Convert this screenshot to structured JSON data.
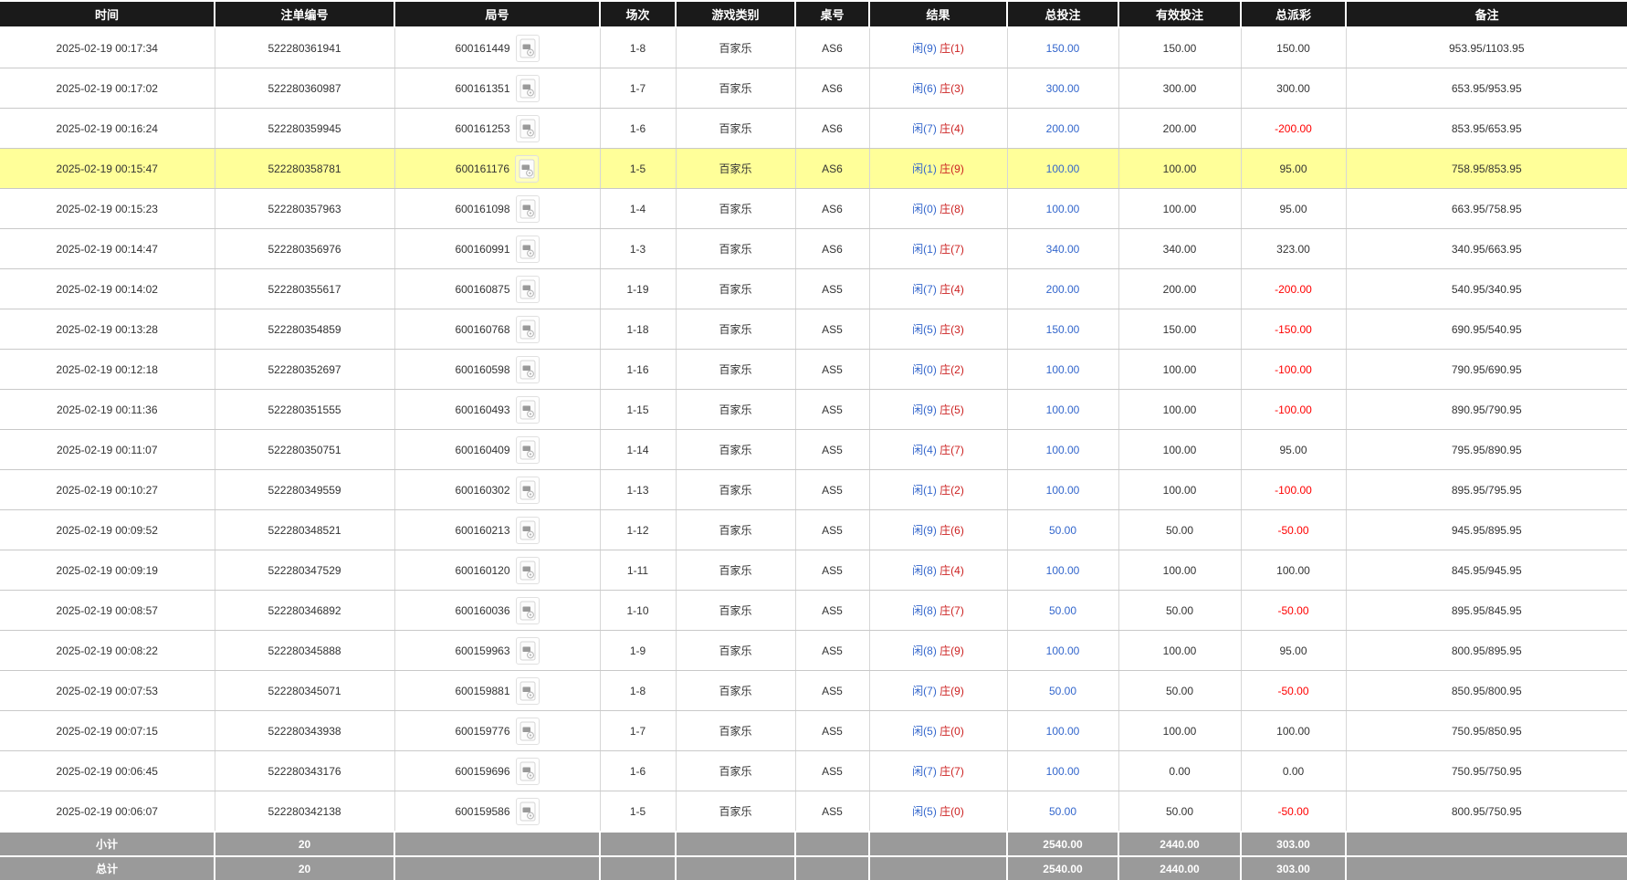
{
  "header": {
    "columns": [
      "时间",
      "注单编号",
      "局号",
      "场次",
      "游戏类别",
      "桌号",
      "结果",
      "总投注",
      "有效投注",
      "总派彩",
      "备注"
    ]
  },
  "rows": [
    {
      "time": "2025-02-19 00:17:34",
      "bet_id": "522280361941",
      "round_id": "600161449",
      "session": "1-8",
      "game_type": "百家乐",
      "table_no": "AS6",
      "result_player": "闲(9)",
      "result_banker": "庄(1)",
      "total_bet": "150.00",
      "valid_bet": "150.00",
      "payout": "150.00",
      "remark": "953.95/1103.95",
      "highlighted": false
    },
    {
      "time": "2025-02-19 00:17:02",
      "bet_id": "522280360987",
      "round_id": "600161351",
      "session": "1-7",
      "game_type": "百家乐",
      "table_no": "AS6",
      "result_player": "闲(6)",
      "result_banker": "庄(3)",
      "total_bet": "300.00",
      "valid_bet": "300.00",
      "payout": "300.00",
      "remark": "653.95/953.95",
      "highlighted": false
    },
    {
      "time": "2025-02-19 00:16:24",
      "bet_id": "522280359945",
      "round_id": "600161253",
      "session": "1-6",
      "game_type": "百家乐",
      "table_no": "AS6",
      "result_player": "闲(7)",
      "result_banker": "庄(4)",
      "total_bet": "200.00",
      "valid_bet": "200.00",
      "payout": "-200.00",
      "remark": "853.95/653.95",
      "highlighted": false
    },
    {
      "time": "2025-02-19 00:15:47",
      "bet_id": "522280358781",
      "round_id": "600161176",
      "session": "1-5",
      "game_type": "百家乐",
      "table_no": "AS6",
      "result_player": "闲(1)",
      "result_banker": "庄(9)",
      "total_bet": "100.00",
      "valid_bet": "100.00",
      "payout": "95.00",
      "remark": "758.95/853.95",
      "highlighted": true
    },
    {
      "time": "2025-02-19 00:15:23",
      "bet_id": "522280357963",
      "round_id": "600161098",
      "session": "1-4",
      "game_type": "百家乐",
      "table_no": "AS6",
      "result_player": "闲(0)",
      "result_banker": "庄(8)",
      "total_bet": "100.00",
      "valid_bet": "100.00",
      "payout": "95.00",
      "remark": "663.95/758.95",
      "highlighted": false
    },
    {
      "time": "2025-02-19 00:14:47",
      "bet_id": "522280356976",
      "round_id": "600160991",
      "session": "1-3",
      "game_type": "百家乐",
      "table_no": "AS6",
      "result_player": "闲(1)",
      "result_banker": "庄(7)",
      "total_bet": "340.00",
      "valid_bet": "340.00",
      "payout": "323.00",
      "remark": "340.95/663.95",
      "highlighted": false
    },
    {
      "time": "2025-02-19 00:14:02",
      "bet_id": "522280355617",
      "round_id": "600160875",
      "session": "1-19",
      "game_type": "百家乐",
      "table_no": "AS5",
      "result_player": "闲(7)",
      "result_banker": "庄(4)",
      "total_bet": "200.00",
      "valid_bet": "200.00",
      "payout": "-200.00",
      "remark": "540.95/340.95",
      "highlighted": false
    },
    {
      "time": "2025-02-19 00:13:28",
      "bet_id": "522280354859",
      "round_id": "600160768",
      "session": "1-18",
      "game_type": "百家乐",
      "table_no": "AS5",
      "result_player": "闲(5)",
      "result_banker": "庄(3)",
      "total_bet": "150.00",
      "valid_bet": "150.00",
      "payout": "-150.00",
      "remark": "690.95/540.95",
      "highlighted": false
    },
    {
      "time": "2025-02-19 00:12:18",
      "bet_id": "522280352697",
      "round_id": "600160598",
      "session": "1-16",
      "game_type": "百家乐",
      "table_no": "AS5",
      "result_player": "闲(0)",
      "result_banker": "庄(2)",
      "total_bet": "100.00",
      "valid_bet": "100.00",
      "payout": "-100.00",
      "remark": "790.95/690.95",
      "highlighted": false
    },
    {
      "time": "2025-02-19 00:11:36",
      "bet_id": "522280351555",
      "round_id": "600160493",
      "session": "1-15",
      "game_type": "百家乐",
      "table_no": "AS5",
      "result_player": "闲(9)",
      "result_banker": "庄(5)",
      "total_bet": "100.00",
      "valid_bet": "100.00",
      "payout": "-100.00",
      "remark": "890.95/790.95",
      "highlighted": false
    },
    {
      "time": "2025-02-19 00:11:07",
      "bet_id": "522280350751",
      "round_id": "600160409",
      "session": "1-14",
      "game_type": "百家乐",
      "table_no": "AS5",
      "result_player": "闲(4)",
      "result_banker": "庄(7)",
      "total_bet": "100.00",
      "valid_bet": "100.00",
      "payout": "95.00",
      "remark": "795.95/890.95",
      "highlighted": false
    },
    {
      "time": "2025-02-19 00:10:27",
      "bet_id": "522280349559",
      "round_id": "600160302",
      "session": "1-13",
      "game_type": "百家乐",
      "table_no": "AS5",
      "result_player": "闲(1)",
      "result_banker": "庄(2)",
      "total_bet": "100.00",
      "valid_bet": "100.00",
      "payout": "-100.00",
      "remark": "895.95/795.95",
      "highlighted": false
    },
    {
      "time": "2025-02-19 00:09:52",
      "bet_id": "522280348521",
      "round_id": "600160213",
      "session": "1-12",
      "game_type": "百家乐",
      "table_no": "AS5",
      "result_player": "闲(9)",
      "result_banker": "庄(6)",
      "total_bet": "50.00",
      "valid_bet": "50.00",
      "payout": "-50.00",
      "remark": "945.95/895.95",
      "highlighted": false
    },
    {
      "time": "2025-02-19 00:09:19",
      "bet_id": "522280347529",
      "round_id": "600160120",
      "session": "1-11",
      "game_type": "百家乐",
      "table_no": "AS5",
      "result_player": "闲(8)",
      "result_banker": "庄(4)",
      "total_bet": "100.00",
      "valid_bet": "100.00",
      "payout": "100.00",
      "remark": "845.95/945.95",
      "highlighted": false
    },
    {
      "time": "2025-02-19 00:08:57",
      "bet_id": "522280346892",
      "round_id": "600160036",
      "session": "1-10",
      "game_type": "百家乐",
      "table_no": "AS5",
      "result_player": "闲(8)",
      "result_banker": "庄(7)",
      "total_bet": "50.00",
      "valid_bet": "50.00",
      "payout": "-50.00",
      "remark": "895.95/845.95",
      "highlighted": false
    },
    {
      "time": "2025-02-19 00:08:22",
      "bet_id": "522280345888",
      "round_id": "600159963",
      "session": "1-9",
      "game_type": "百家乐",
      "table_no": "AS5",
      "result_player": "闲(8)",
      "result_banker": "庄(9)",
      "total_bet": "100.00",
      "valid_bet": "100.00",
      "payout": "95.00",
      "remark": "800.95/895.95",
      "highlighted": false
    },
    {
      "time": "2025-02-19 00:07:53",
      "bet_id": "522280345071",
      "round_id": "600159881",
      "session": "1-8",
      "game_type": "百家乐",
      "table_no": "AS5",
      "result_player": "闲(7)",
      "result_banker": "庄(9)",
      "total_bet": "50.00",
      "valid_bet": "50.00",
      "payout": "-50.00",
      "remark": "850.95/800.95",
      "highlighted": false
    },
    {
      "time": "2025-02-19 00:07:15",
      "bet_id": "522280343938",
      "round_id": "600159776",
      "session": "1-7",
      "game_type": "百家乐",
      "table_no": "AS5",
      "result_player": "闲(5)",
      "result_banker": "庄(0)",
      "total_bet": "100.00",
      "valid_bet": "100.00",
      "payout": "100.00",
      "remark": "750.95/850.95",
      "highlighted": false
    },
    {
      "time": "2025-02-19 00:06:45",
      "bet_id": "522280343176",
      "round_id": "600159696",
      "session": "1-6",
      "game_type": "百家乐",
      "table_no": "AS5",
      "result_player": "闲(7)",
      "result_banker": "庄(7)",
      "total_bet": "100.00",
      "valid_bet": "0.00",
      "payout": "0.00",
      "remark": "750.95/750.95",
      "highlighted": false
    },
    {
      "time": "2025-02-19 00:06:07",
      "bet_id": "522280342138",
      "round_id": "600159586",
      "session": "1-5",
      "game_type": "百家乐",
      "table_no": "AS5",
      "result_player": "闲(5)",
      "result_banker": "庄(0)",
      "total_bet": "50.00",
      "valid_bet": "50.00",
      "payout": "-50.00",
      "remark": "800.95/750.95",
      "highlighted": false
    }
  ],
  "footer": {
    "subtotal": {
      "label": "小计",
      "count": "20",
      "total_bet": "2540.00",
      "valid_bet": "2440.00",
      "payout": "303.00"
    },
    "total": {
      "label": "总计",
      "count": "20",
      "total_bet": "2540.00",
      "valid_bet": "2440.00",
      "payout": "303.00"
    }
  },
  "icons": {
    "round_record_icon": "game-record-icon"
  },
  "colors": {
    "header_bg": "#1a1a1a",
    "header_text": "#ffffff",
    "highlight_row_bg": "#ffff99",
    "player_blue": "#3366cc",
    "banker_red": "#cc2222",
    "bet_link_blue": "#3366cc",
    "negative_red": "#ff0000",
    "footer_bg": "#9a9a9a",
    "footer_text": "#ffffff",
    "row_border": "#cccccc",
    "body_text": "#333333"
  }
}
